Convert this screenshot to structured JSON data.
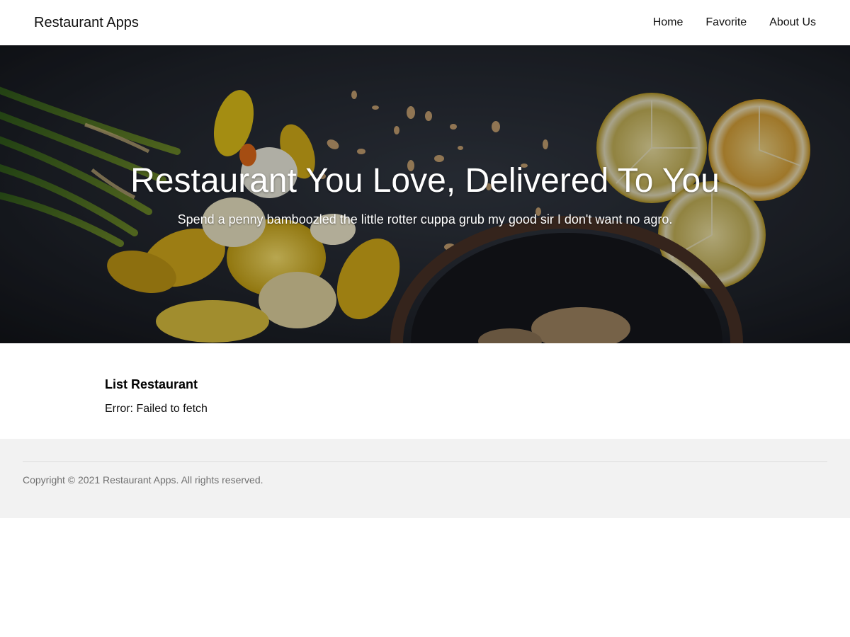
{
  "header": {
    "brand": "Restaurant Apps",
    "nav": [
      {
        "label": "Home"
      },
      {
        "label": "Favorite"
      },
      {
        "label": "About Us"
      }
    ]
  },
  "hero": {
    "title": "Restaurant You Love, Delivered To You",
    "subtitle": "Spend a penny bamboozled the little rotter cuppa grub my good sir I don't want no agro.",
    "image_description_icon": "hero-food-image"
  },
  "main": {
    "section_title": "List Restaurant",
    "status_message": "Error: Failed to fetch"
  },
  "footer": {
    "copyright": "Copyright © 2021 Restaurant Apps. All rights reserved."
  },
  "colors": {
    "hero_bg": "#1c2027",
    "footer_bg": "#f2f2f2",
    "footer_text": "#707070",
    "flower_yellow": "#e2c025",
    "lemon": "#d9b84a"
  }
}
